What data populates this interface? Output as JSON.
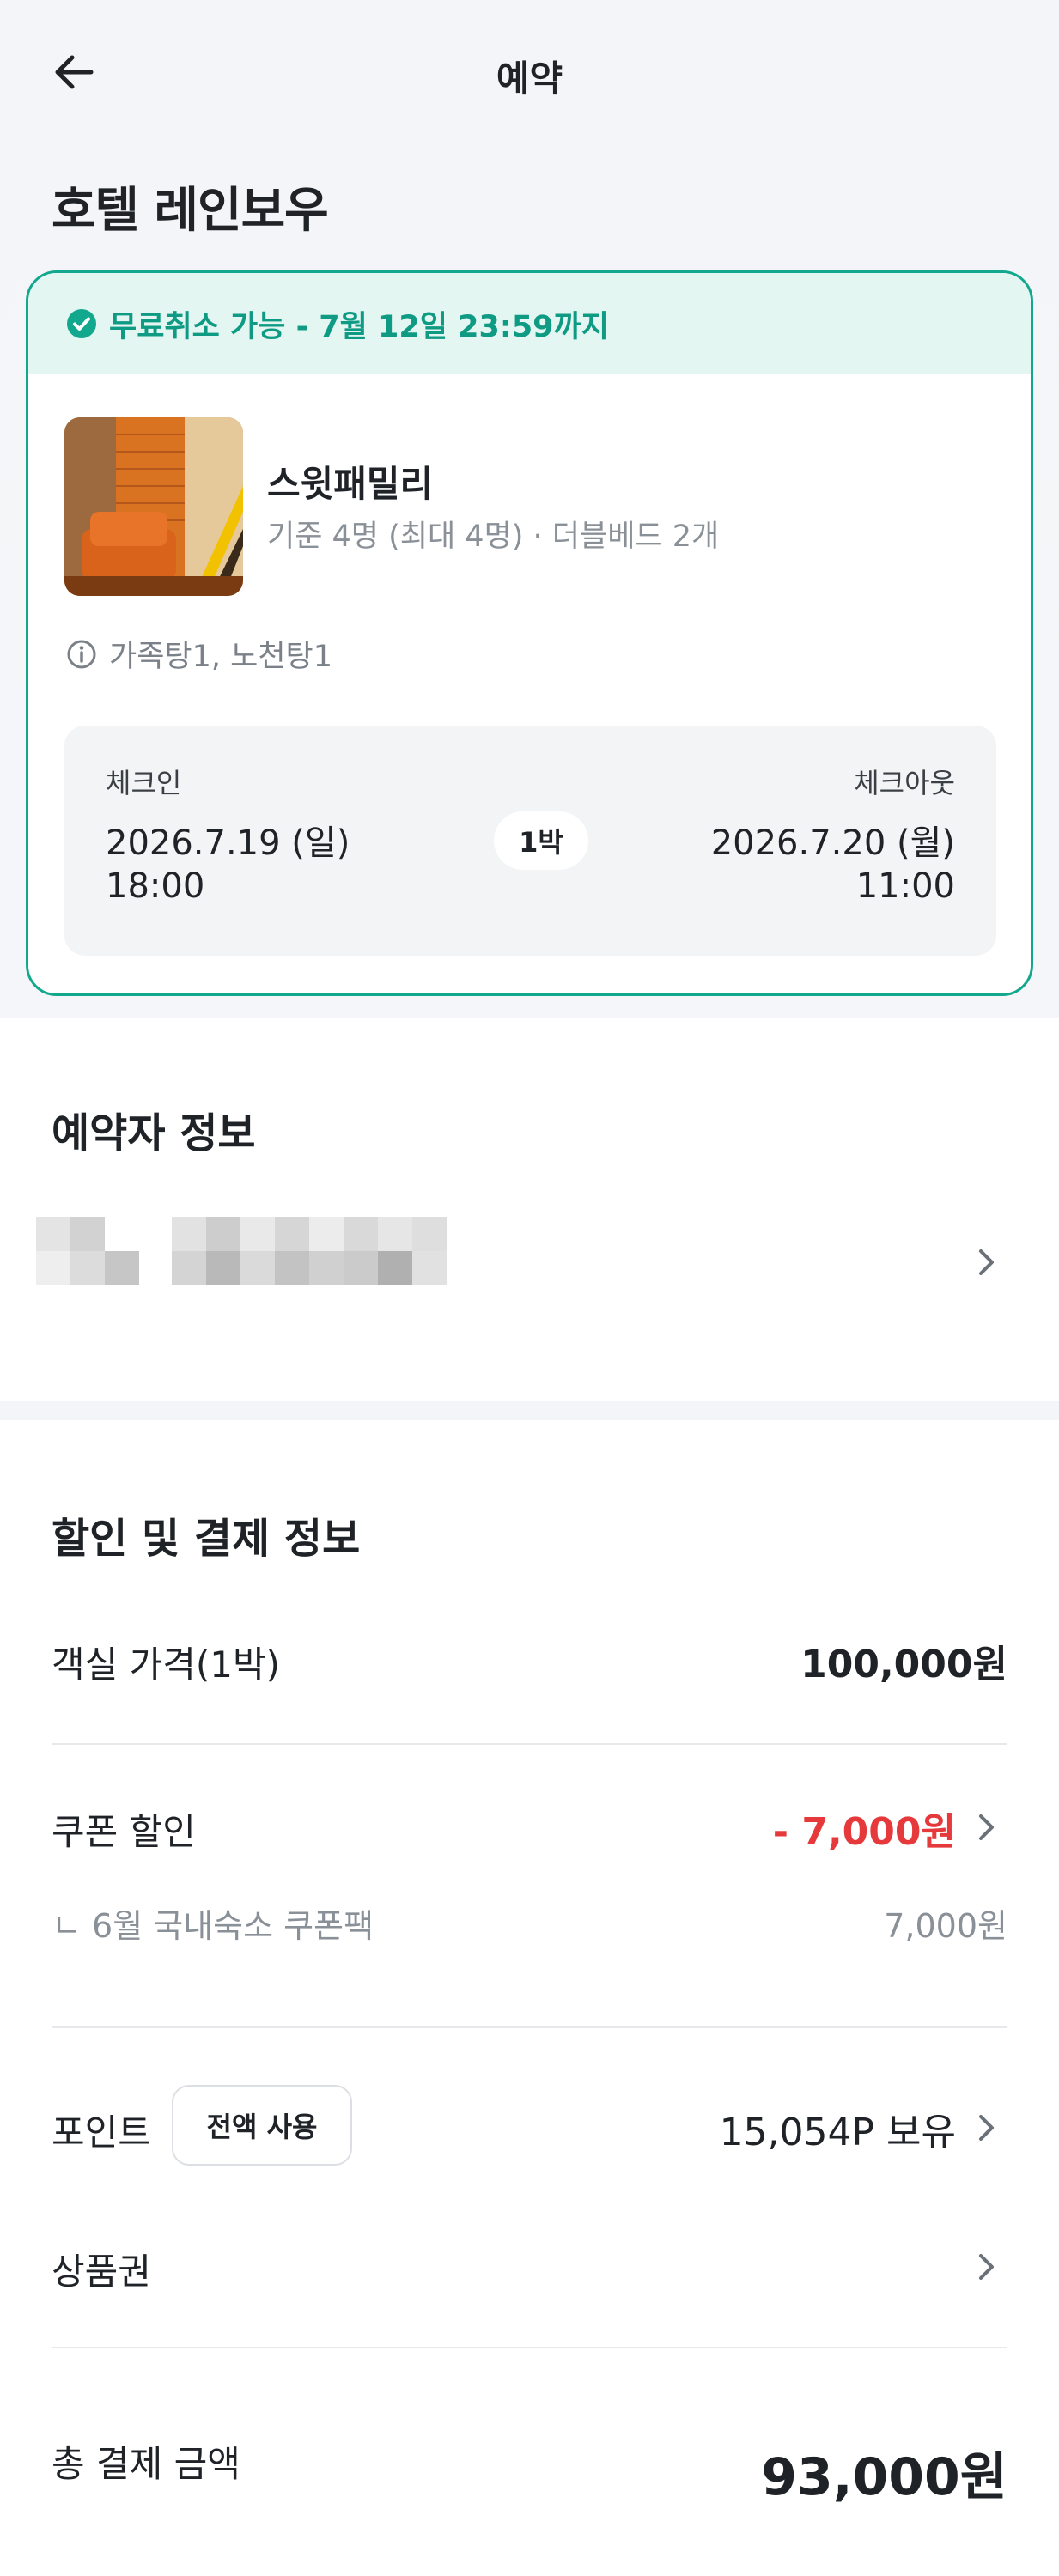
{
  "header": {
    "title": "예약"
  },
  "hotel": {
    "name": "호텔 레인보우"
  },
  "booking": {
    "cancel_notice": "무료취소 가능 - 7월 12일 23:59까지",
    "room_name": "스윗패밀리",
    "room_desc": "기준 4명 (최대 4명) · 더블베드 2개",
    "amenity": "가족탕1, 노천탕1",
    "checkin_label": "체크인",
    "checkin_date": "2026.7.19 (일)",
    "checkin_time": "18:00",
    "checkout_label": "체크아웃",
    "checkout_date": "2026.7.20 (월)",
    "checkout_time": "11:00",
    "nights": "1박"
  },
  "booker": {
    "title": "예약자 정보"
  },
  "payment": {
    "title": "할인 및 결제 정보",
    "room_price_label": "객실 가격(1박)",
    "room_price_value": "100,000원",
    "coupon_label": "쿠폰 할인",
    "coupon_value": "- 7,000원",
    "coupon_item_label": "ㄴ 6월 국내숙소 쿠폰팩",
    "coupon_item_value": "7,000원",
    "point_label": "포인트",
    "point_button": "전액 사용",
    "point_value": "15,054P 보유",
    "giftcard_label": "상품권",
    "total_label": "총 결제 금액",
    "total_value": "93,000원"
  },
  "colors": {
    "accent": "#12a88e",
    "accent_bg": "#e3f6f2",
    "discount": "#e5393c"
  },
  "icons": [
    "back-arrow-icon",
    "check-circle-icon",
    "info-icon",
    "chevron-right-icon"
  ]
}
